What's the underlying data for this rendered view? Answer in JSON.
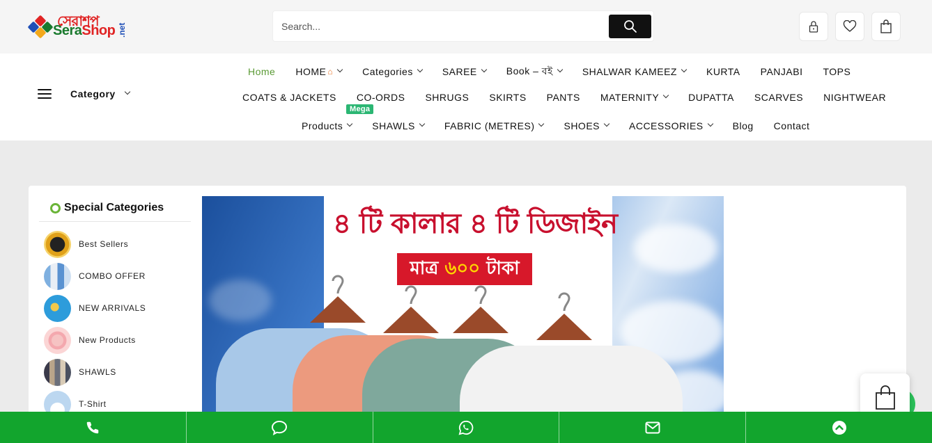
{
  "brand": {
    "logo_bn": "সেরাশপ",
    "logo_en_1": "Sera",
    "logo_en_2": "Shop",
    "logo_net": ".net",
    "colors": {
      "green": "#1a7a2e",
      "red": "#e02424",
      "blue": "#1f4fb7"
    }
  },
  "search": {
    "placeholder": "Search...",
    "icon": "search-icon"
  },
  "header_icons": [
    "lock-icon",
    "heart-icon",
    "shopping-bag-icon"
  ],
  "category_menu": {
    "label": "Category"
  },
  "nav": {
    "row1": [
      {
        "label": "Home",
        "active": true
      },
      {
        "label": "HOME",
        "dropdown": true,
        "icon": "house-icon"
      },
      {
        "label": "Categories",
        "dropdown": true
      },
      {
        "label": "SAREE",
        "dropdown": true
      },
      {
        "label": "Book – বই",
        "dropdown": true
      },
      {
        "label": "SHALWAR KAMEEZ",
        "dropdown": true
      },
      {
        "label": "KURTA"
      },
      {
        "label": "PANJABI"
      },
      {
        "label": "TOPS"
      }
    ],
    "row2": [
      {
        "label": "COATS & JACKETS"
      },
      {
        "label": "CO-ORDS"
      },
      {
        "label": "SHRUGS"
      },
      {
        "label": "SKIRTS"
      },
      {
        "label": "PANTS"
      },
      {
        "label": "MATERNITY",
        "dropdown": true
      },
      {
        "label": "DUPATTA"
      },
      {
        "label": "SCARVES"
      },
      {
        "label": "NIGHTWEAR"
      }
    ],
    "row3": [
      {
        "label": "Products",
        "dropdown": true,
        "badge": "Mega"
      },
      {
        "label": "SHAWLS",
        "dropdown": true
      },
      {
        "label": "FABRIC (METRES)",
        "dropdown": true
      },
      {
        "label": "SHOES",
        "dropdown": true
      },
      {
        "label": "ACCESSORIES",
        "dropdown": true
      },
      {
        "label": "Blog"
      },
      {
        "label": "Contact"
      }
    ]
  },
  "special_categories": {
    "title": "Special Categories",
    "items": [
      {
        "label": "Best Sellers"
      },
      {
        "label": "COMBO OFFER"
      },
      {
        "label": "NEW ARRIVALS"
      },
      {
        "label": "New Products"
      },
      {
        "label": "SHAWLS"
      },
      {
        "label": "T-Shirt"
      }
    ]
  },
  "banner": {
    "headline": "৪ টি কালার ৪ টি ডিজাইন",
    "price_prefix": "মাত্র",
    "price_value": "৬০০",
    "price_suffix": "টাকা"
  },
  "bottom_bar": {
    "color": "#12a52d",
    "items": [
      "phone-icon",
      "chat-icon",
      "whatsapp-icon",
      "mail-icon",
      "scroll-top-icon"
    ]
  }
}
